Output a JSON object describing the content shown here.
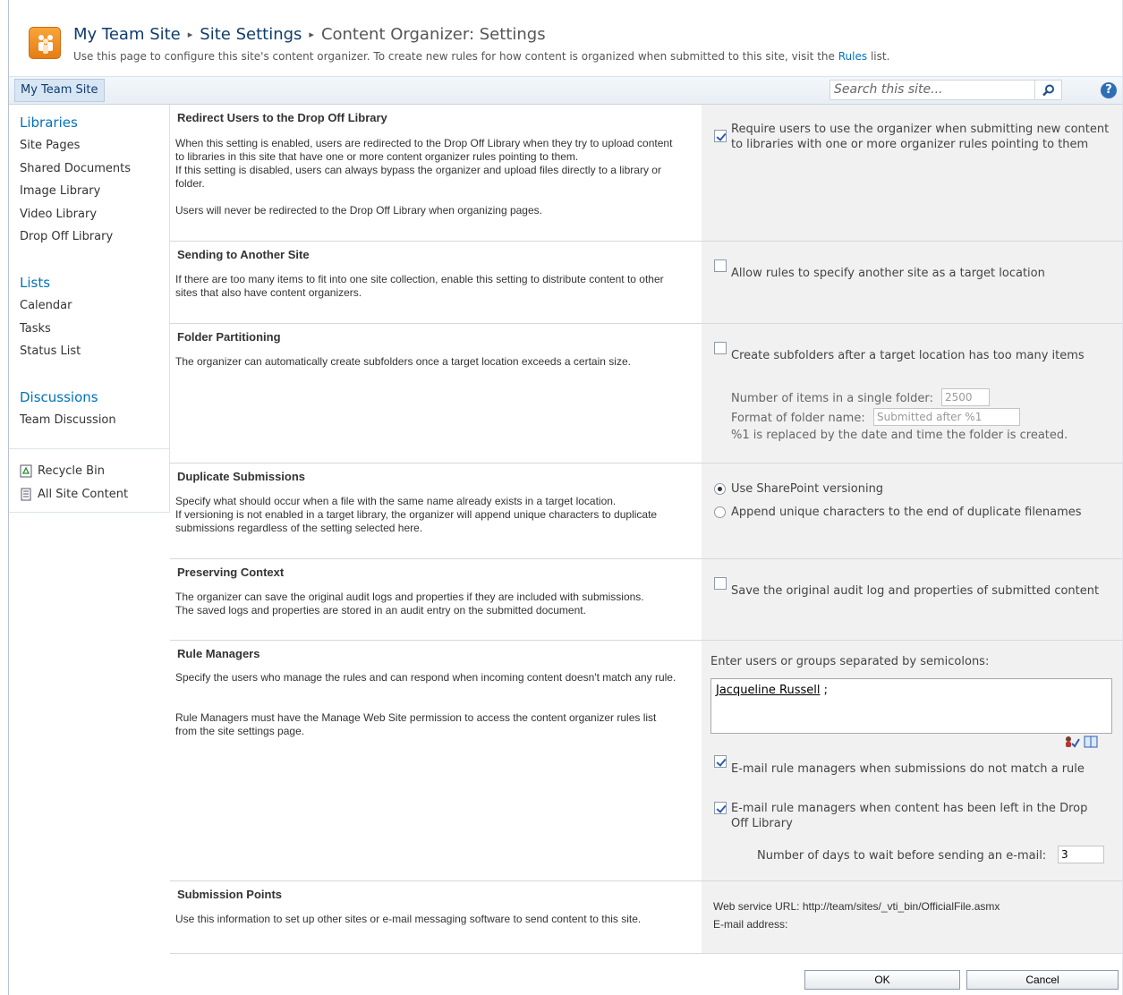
{
  "header": {
    "breadcrumb": [
      "My Team Site",
      "Site Settings",
      "Content Organizer: Settings"
    ],
    "separator": "▸",
    "description_prefix": "Use this page to configure this site's content organizer. To create new rules for how content is organized when submitted to this site, visit the",
    "description_link": "Rules",
    "description_suffix": "list."
  },
  "topnav": {
    "tab_label": "My Team Site",
    "search_placeholder": "Search this site...",
    "help": "?"
  },
  "leftnav": {
    "libraries_heading": "Libraries",
    "libraries": [
      "Site Pages",
      "Shared Documents",
      "Image Library",
      "Video Library",
      "Drop Off Library"
    ],
    "lists_heading": "Lists",
    "lists": [
      "Calendar",
      "Tasks",
      "Status List"
    ],
    "discussions_heading": "Discussions",
    "discussions": [
      "Team Discussion"
    ],
    "recycle_bin": "Recycle Bin",
    "all_site_content": "All Site Content"
  },
  "sections": {
    "redirect": {
      "title": "Redirect Users to the Drop Off Library",
      "desc1": "When this setting is enabled, users are redirected to the Drop Off Library when they try to upload content to libraries in this site that have one or more content organizer rules pointing to them.",
      "desc2": "If this setting is disabled, users can always bypass the organizer and upload files directly to a library or folder.",
      "desc3": "Users will never be redirected to the Drop Off Library when organizing pages.",
      "checkbox_label": "Require users to use the organizer when submitting new content to libraries with one or more organizer rules pointing to them",
      "checked": true
    },
    "another_site": {
      "title": "Sending to Another Site",
      "desc": "If there are too many items to fit into one site collection, enable this setting to distribute content to other sites that also have content organizers.",
      "checkbox_label": "Allow rules to specify another site as a target location",
      "checked": false
    },
    "folder": {
      "title": "Folder Partitioning",
      "desc": "The organizer can automatically create subfolders once a target location exceeds a certain size.",
      "checkbox_label": "Create subfolders after a target location has too many items",
      "checked": false,
      "items_label": "Number of items in a single folder:",
      "items_value": "2500",
      "format_label": "Format of folder name:",
      "format_value": "Submitted after %1",
      "note": "%1 is replaced by the date and time the folder is created."
    },
    "duplicate": {
      "title": "Duplicate Submissions",
      "desc1": "Specify what should occur when a file with the same name already exists in a target location.",
      "desc2": "If versioning is not enabled in a target library, the organizer will append unique characters to duplicate submissions regardless of the setting selected here.",
      "option1": "Use SharePoint versioning",
      "option2": "Append unique characters to the end of duplicate filenames",
      "selected": 1
    },
    "context": {
      "title": "Preserving Context",
      "desc1": "The organizer can save the original audit logs and properties if they are included with submissions.",
      "desc2": "The saved logs and properties are stored in an audit entry on the submitted document.",
      "checkbox_label": "Save the original audit log and properties of submitted content",
      "checked": false
    },
    "managers": {
      "title": "Rule Managers",
      "desc1": "Specify the users who manage the rules and can respond when incoming content doesn't match any rule.",
      "desc2": "Rule Managers must have the Manage Web Site permission to access the content organizer rules list from the site settings page.",
      "people_label": "Enter users or groups separated by semicolons:",
      "person": "Jacqueline Russell",
      "person_sep": ";",
      "email1_label": "E-mail rule managers when submissions do not match a rule",
      "email1_checked": true,
      "email2_label": "E-mail rule managers when content has been left in the Drop Off Library",
      "email2_checked": true,
      "days_label": "Number of days to wait before sending an e-mail:",
      "days_value": "3"
    },
    "submission": {
      "title": "Submission Points",
      "desc": "Use this information to set up other sites or e-mail messaging software to send content to this site.",
      "url_label": "Web service URL:",
      "url_value": "http://team/sites/_vti_bin/OfficialFile.asmx",
      "email_label": "E-mail address:"
    }
  },
  "buttons": {
    "ok": "OK",
    "cancel": "Cancel"
  }
}
